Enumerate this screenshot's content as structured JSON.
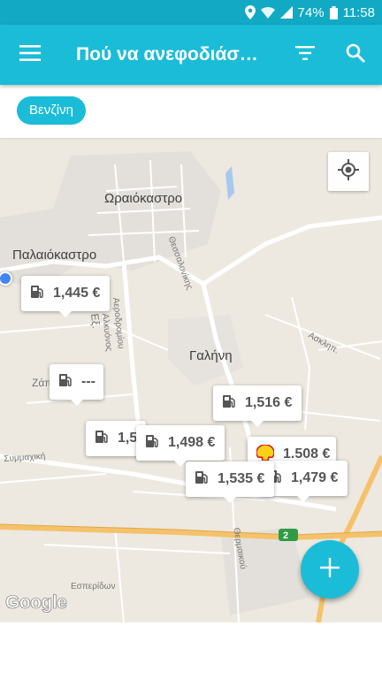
{
  "status_bar": {
    "battery": "74%",
    "time": "11:58"
  },
  "app_bar": {
    "title": "Πού να ανεφοδιάσ…",
    "menu_icon": "hamburger-menu-icon",
    "filter_icon": "filter-icon",
    "search_icon": "search-icon"
  },
  "filter_chip": {
    "label": "Βενζίνη"
  },
  "map": {
    "places": [
      "Ωραιόκαστρο",
      "Παλαιόκαστρο",
      "Γαλήνη"
    ],
    "streets": [
      "Αεροδρομίου",
      "Αλκυόνος",
      "Θεσσαλονίκης",
      "Ασκληπ.",
      "Συμμαχική",
      "Εσπερίδων",
      "Θερμαικού",
      "Ζάπ",
      "Εξ."
    ],
    "route_badge": "2",
    "attribution": "Google"
  },
  "stations": [
    {
      "price": "1,445 €",
      "brand": "generic"
    },
    {
      "price": "---",
      "brand": "generic"
    },
    {
      "price": "1,516 €",
      "brand": "generic"
    },
    {
      "price": "1,5",
      "brand": "generic"
    },
    {
      "price": "1,498 €",
      "brand": "generic"
    },
    {
      "price": "1.508 €",
      "brand": "shell"
    },
    {
      "price": "1,479 €",
      "brand": "generic"
    },
    {
      "price": "1,535 €",
      "brand": "generic"
    }
  ],
  "colors": {
    "primary": "#1bbcd8",
    "status_bar": "#11a9c3",
    "map_bg": "#ede9e1",
    "road": "#ffffff",
    "highway": "#f5c26b"
  }
}
